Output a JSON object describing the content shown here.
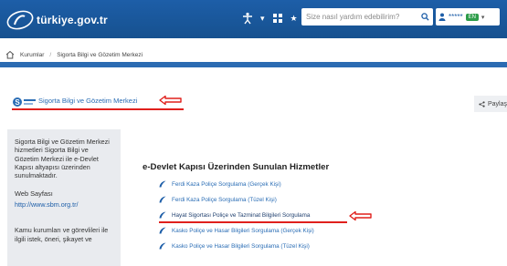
{
  "header": {
    "logo_text": "türkiye.gov.tr",
    "search_placeholder": "Size nasıl yardım edebilirim?",
    "user_masked": "*****",
    "user_badge": "EN"
  },
  "breadcrumb": {
    "items": [
      "Kurumlar",
      "Sigorta Bilgi ve Gözetim Merkezi"
    ]
  },
  "title_row": {
    "institution_name": "Sigorta Bilgi ve Gözetim Merkezi",
    "share_label": "Paylaş"
  },
  "sidebar": {
    "description": "Sigorta Bilgi ve Gözetim Merkezi hizmetleri Sigorta Bilgi ve Gözetim Merkezi ile e-Devlet Kapısı altyapısı üzerinden sunulmaktadır.",
    "web_title": "Web Sayfası",
    "web_link": "http://www.sbm.org.tr/",
    "note": "Kamu kurumları ve görevlileri ile ilgili istek, öneri, şikayet ve"
  },
  "main": {
    "heading": "e-Devlet Kapısı Üzerinden Sunulan Hizmetler",
    "services": [
      {
        "label": "Ferdi Kaza Poliçe Sorgulama (Gerçek Kişi)"
      },
      {
        "label": "Ferdi Kaza Poliçe Sorgulama (Tüzel Kişi)"
      },
      {
        "label": "Hayat Sigortası Poliçe ve Tazminat Bilgileri Sorgulama"
      },
      {
        "label": "Kasko Poliçe ve Hasar Bilgileri Sorgulama (Gerçek Kişi)"
      },
      {
        "label": "Kasko Poliçe ve Hasar Bilgileri Sorgulama (Tüzel Kişi)"
      }
    ]
  },
  "colors": {
    "header_blue": "#1d5ea8",
    "link_blue": "#2a6db5",
    "annotation_red": "#e0201c",
    "sidebar_bg": "#e9ebef"
  }
}
